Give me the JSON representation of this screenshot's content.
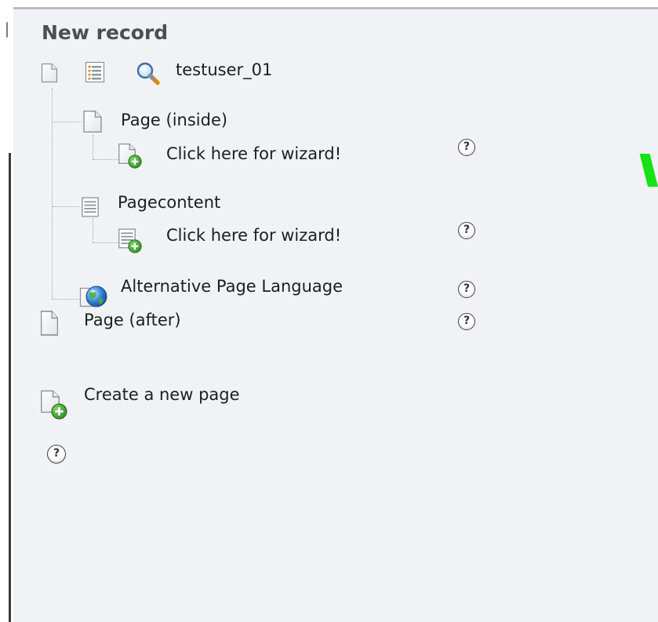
{
  "title": "New record",
  "current_page": {
    "name": "testuser_01",
    "icons": [
      "page-icon",
      "list-module-icon",
      "search-icon"
    ]
  },
  "tree": {
    "page_inside": {
      "label": "Page (inside)",
      "icon": "page-icon",
      "wizard": {
        "label": "Click here for wizard!",
        "icon": "page-new-icon",
        "help": "?"
      }
    },
    "pagecontent": {
      "label": "Pagecontent",
      "icon": "content-icon",
      "wizard": {
        "label": "Click here for wizard!",
        "icon": "content-new-icon",
        "help": "?"
      }
    },
    "alt_language": {
      "label": "Alternative Page Language",
      "icon": "globe-icon",
      "help": "?"
    }
  },
  "page_after": {
    "label": "Page (after)",
    "icon": "page-icon",
    "help": "?"
  },
  "create_page": {
    "label": "Create a new page",
    "icon": "page-new-icon"
  },
  "bottom_help": "?",
  "colors": {
    "panel_bg": "#f1f2f6",
    "title": "#4b4e56",
    "text": "#1e1e1e",
    "accent_green": "#16e216",
    "plus_badge": "#3e9a2c",
    "tree_lines": "#a8a8a8"
  }
}
